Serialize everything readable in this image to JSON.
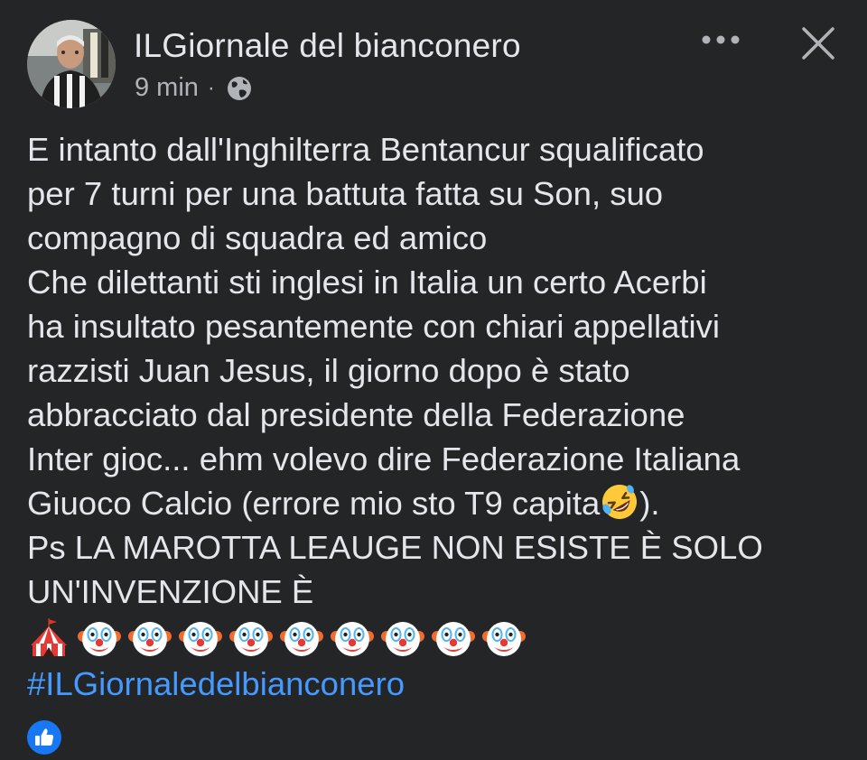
{
  "post": {
    "author": "ILGiornale del bianconero",
    "time": "9 min",
    "separator": "·",
    "audience_icon": "globe-icon",
    "menu_icon": "more-horizontal-icon",
    "close_icon": "close-icon",
    "body_lines": [
      "E intanto dall'Inghilterra Bentancur squalificato",
      "per 7 turni per una battuta fatta su Son, suo",
      "compagno di squadra ed amico",
      "Che dilettanti sti inglesi in Italia un certo Acerbi",
      "ha insultato pesantemente con chiari appellativi",
      "razzisti Juan Jesus, il giorno dopo è stato",
      "abbracciato dal presidente della Federazione",
      "Inter gioc... ehm volevo dire Federazione Italiana"
    ],
    "line9_before_emoji": "Giuoco Calcio (errore mio sto T9 capita",
    "line9_emoji": "rolling-on-floor-laughing-emoji",
    "line9_after_emoji": ").",
    "line10": "Ps LA MAROTTA LEAUGE NON ESISTE È SOLO",
    "line11": "UN'INVENZIONE È",
    "emoji_row": [
      "circus-tent-emoji",
      "clown-face-emoji",
      "clown-face-emoji",
      "clown-face-emoji",
      "clown-face-emoji",
      "clown-face-emoji",
      "clown-face-emoji",
      "clown-face-emoji",
      "clown-face-emoji",
      "clown-face-emoji"
    ],
    "hashtag": "#ILGiornaledelbianconero",
    "reaction_icon": "like-reaction-icon"
  },
  "colors": {
    "background": "#242526",
    "text_primary": "#E4E6EB",
    "text_secondary": "#B0B3B8",
    "link": "#4599FF",
    "like_blue": "#1877F2"
  }
}
